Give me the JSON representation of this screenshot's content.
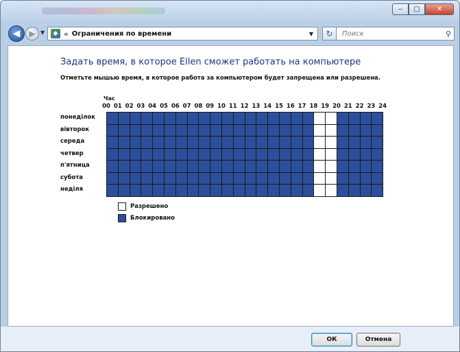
{
  "window": {
    "controls": {
      "minimize": "‒",
      "maximize": "▢",
      "close": "✕"
    }
  },
  "nav": {
    "back_glyph": "◀",
    "forward_glyph": "▶",
    "address_text": "Ограничения по времени",
    "address_chevron": "«",
    "search_placeholder": "Поиск"
  },
  "page": {
    "title": "Задать время, в которое Ellen сможет работать на компьютере",
    "instruction": "Отметьте мышью время, в которое работа за компьютером будет запрещена или разрешена.",
    "hour_caption": "Час"
  },
  "schedule": {
    "hours": [
      "00",
      "01",
      "02",
      "03",
      "04",
      "05",
      "06",
      "07",
      "08",
      "09",
      "10",
      "11",
      "12",
      "13",
      "14",
      "15",
      "16",
      "17",
      "18",
      "19",
      "20",
      "21",
      "22",
      "23",
      "24"
    ],
    "days": [
      "понеділок",
      "вівторок",
      "середа",
      "четвер",
      "п'ятница",
      "субота",
      "неділя"
    ],
    "allowed_hours": [
      18,
      19
    ],
    "colors": {
      "blocked": "#2c4f9c",
      "allowed": "#ffffff"
    }
  },
  "legend": {
    "allowed_label": "Разрешено",
    "blocked_label": "Блокировано"
  },
  "footer": {
    "ok_label": "ОК",
    "cancel_label": "Отмена"
  }
}
